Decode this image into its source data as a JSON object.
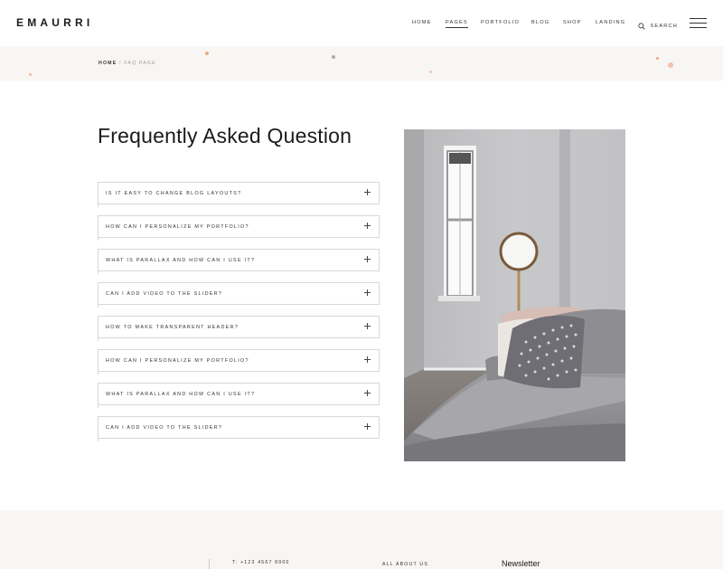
{
  "header": {
    "logo": "EMAURRI",
    "nav": [
      {
        "label": "HOME",
        "active": false
      },
      {
        "label": "PAGES",
        "active": true
      },
      {
        "label": "PORTFOLIO",
        "active": false
      },
      {
        "label": "BLOG",
        "active": false
      },
      {
        "label": "SHOP",
        "active": false
      },
      {
        "label": "LANDING",
        "active": false
      }
    ],
    "search_label": "SEARCH",
    "search_icon": "search-icon",
    "menu_icon": "hamburger-menu-icon"
  },
  "breadcrumb": {
    "home": "HOME",
    "separator": "/",
    "current": "FAQ PAGE"
  },
  "main": {
    "title": "Frequently Asked Question",
    "faq": [
      {
        "question": "IS IT EASY TO CHANGE BLOG LAYOUTS?"
      },
      {
        "question": "HOW CAN I PERSONALIZE MY PORTFOLIO?"
      },
      {
        "question": "WHAT IS PARALLAX AND HOW CAN I USE IT?"
      },
      {
        "question": "CAN I ADD VIDEO TO THE SLIDER?"
      },
      {
        "question": "HOW TO MAKE TRANSPARENT HEADER?"
      },
      {
        "question": "HOW CAN I PERSONALIZE MY PORTFOLIO?"
      },
      {
        "question": "WHAT IS PARALLAX AND HOW CAN I USE IT?"
      },
      {
        "question": "CAN I ADD VIDEO TO THE SLIDER?"
      }
    ],
    "expand_icon": "plus-icon"
  },
  "footer": {
    "phone": "T: +123 4567 8900",
    "about": "ALL ABOUT US",
    "newsletter": "Newsletter"
  },
  "colors": {
    "band_bg": "#f8f6f3",
    "accent_dot": "#f0a882",
    "border": "#d8d8d8",
    "text": "#1b1b1b"
  }
}
